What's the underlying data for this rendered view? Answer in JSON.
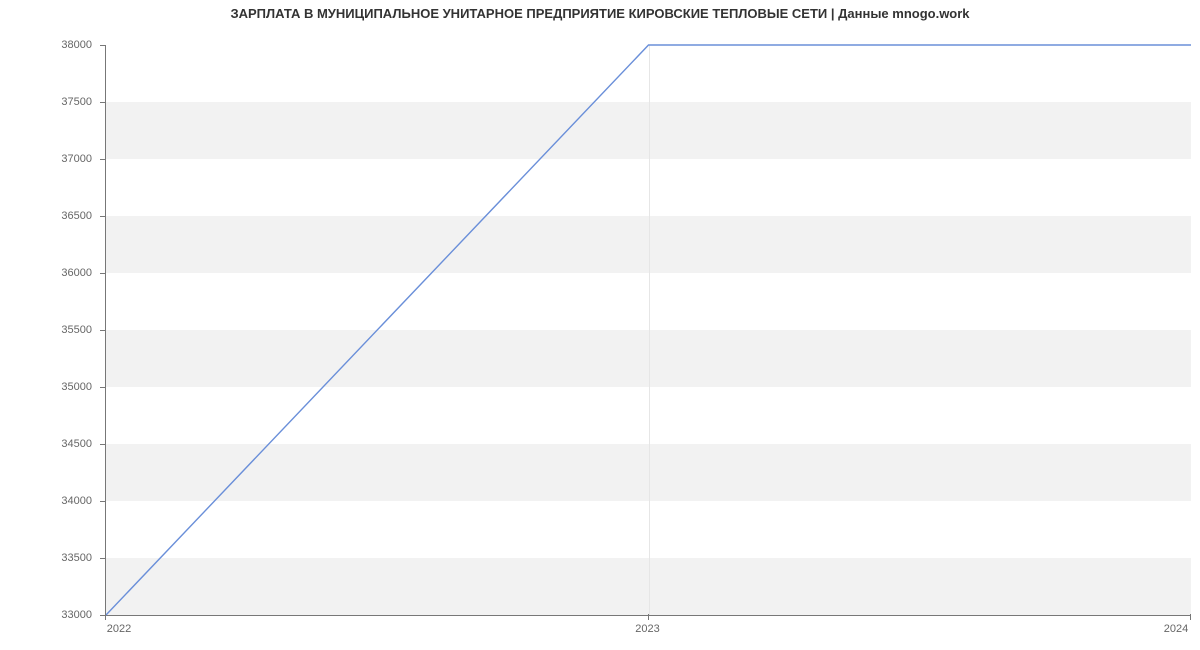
{
  "title": "ЗАРПЛАТА В МУНИЦИПАЛЬНОЕ УНИТАРНОЕ ПРЕДПРИЯТИЕ КИРОВСКИЕ ТЕПЛОВЫЕ СЕТИ | Данные mnogo.work",
  "yticks": [
    "33000",
    "33500",
    "34000",
    "34500",
    "35000",
    "35500",
    "36000",
    "36500",
    "37000",
    "37500",
    "38000"
  ],
  "xticks": [
    "2022",
    "2023",
    "2024"
  ],
  "chart_data": {
    "type": "line",
    "title": "ЗАРПЛАТА В МУНИЦИПАЛЬНОЕ УНИТАРНОЕ ПРЕДПРИЯТИЕ КИРОВСКИЕ ТЕПЛОВЫЕ СЕТИ | Данные mnogo.work",
    "xlabel": "",
    "ylabel": "",
    "x": [
      2022,
      2023,
      2024
    ],
    "values": [
      33000,
      38000,
      38000
    ],
    "ylim": [
      33000,
      38000
    ],
    "xlim": [
      2022,
      2024
    ],
    "grid": true
  },
  "colors": {
    "line": "#6a8fd9",
    "band": "#f2f2f2"
  }
}
